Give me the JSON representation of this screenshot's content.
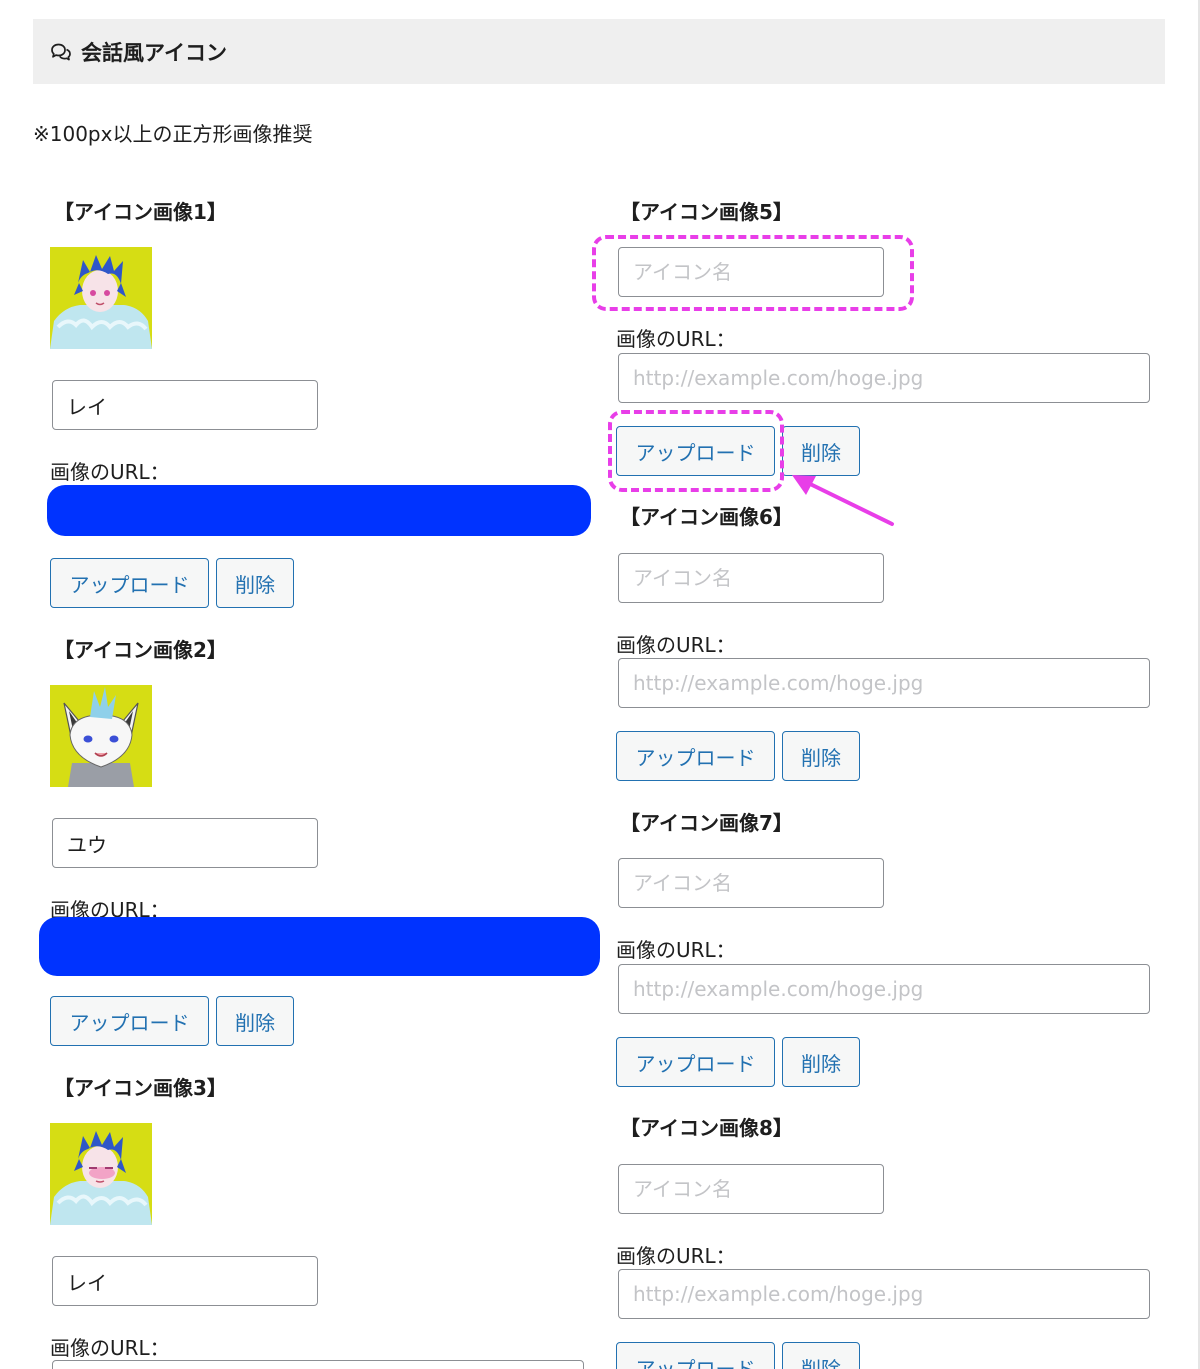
{
  "header": {
    "title": "会話風アイコン",
    "icon": "speech-bubbles-icon"
  },
  "note": "※100px以上の正方形画像推奨",
  "url_label": "画像のURL：",
  "upload_label": "アップロード",
  "delete_label": "削除",
  "name_placeholder": "アイコン名",
  "url_placeholder": "http://example.com/hoge.jpg",
  "icons": [
    {
      "title": "【アイコン画像1】",
      "name": "レイ"
    },
    {
      "title": "【アイコン画像2】",
      "name": "ユウ"
    },
    {
      "title": "【アイコン画像3】",
      "name": "レイ"
    },
    {
      "title": "【アイコン画像5】",
      "name": ""
    },
    {
      "title": "【アイコン画像6】",
      "name": ""
    },
    {
      "title": "【アイコン画像7】",
      "name": ""
    },
    {
      "title": "【アイコン画像8】",
      "name": ""
    }
  ],
  "colors": {
    "header_bg": "#efefef",
    "avatar_bg": "#d6dd14",
    "button_text": "#2271b1",
    "redaction": "#0033ff",
    "highlight": "#e83ee8"
  }
}
